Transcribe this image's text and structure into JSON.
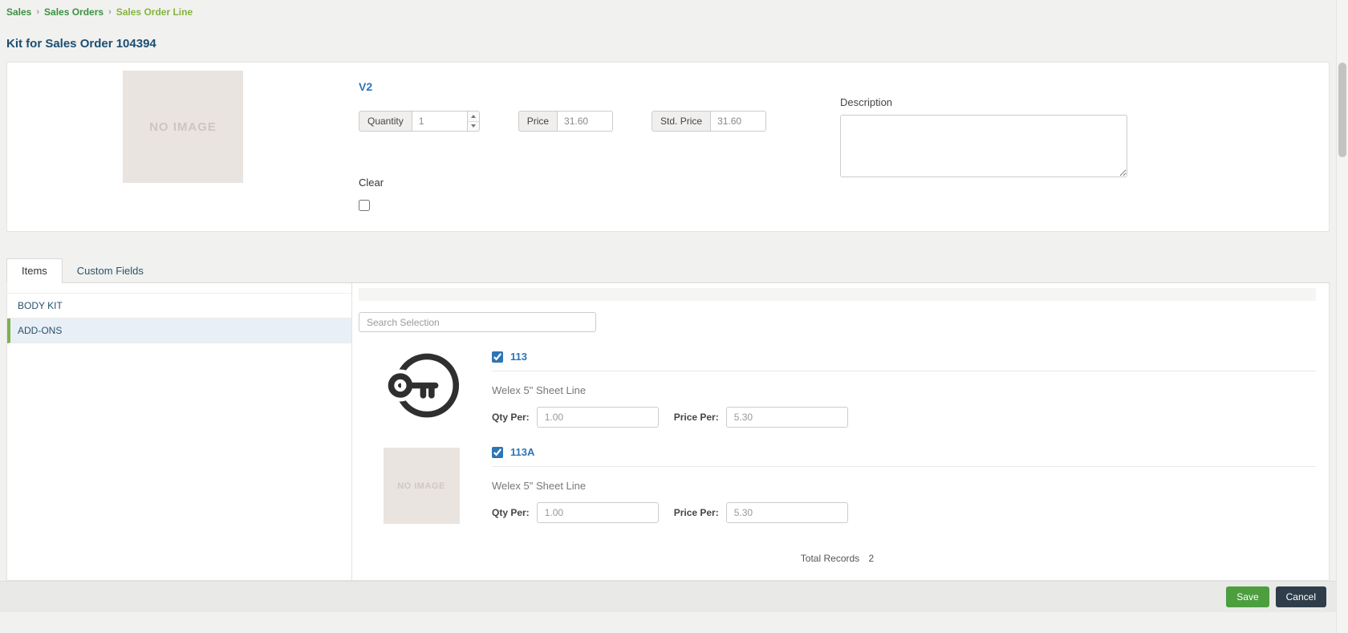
{
  "breadcrumb": {
    "separator": "›",
    "items": [
      {
        "label": "Sales"
      },
      {
        "label": "Sales Orders"
      },
      {
        "label": "Sales Order Line"
      }
    ]
  },
  "page": {
    "title": "Kit for Sales Order 104394"
  },
  "product_panel": {
    "image_placeholder": "NO IMAGE",
    "name": "V2",
    "quantity": {
      "label": "Quantity",
      "value": "1"
    },
    "price": {
      "label": "Price",
      "value": "31.60"
    },
    "std_price": {
      "label": "Std. Price",
      "value": "31.60"
    },
    "description": {
      "label": "Description",
      "value": ""
    },
    "clear": {
      "label": "Clear",
      "checked": false
    }
  },
  "tabs": [
    {
      "label": "Items",
      "active": true
    },
    {
      "label": "Custom Fields",
      "active": false
    }
  ],
  "categories": [
    {
      "label": "BODY KIT",
      "selected": false
    },
    {
      "label": "ADD-ONS",
      "selected": true
    }
  ],
  "search": {
    "placeholder": "Search Selection"
  },
  "items": [
    {
      "code": "113",
      "description": "Welex 5\" Sheet Line",
      "qty_per_label": "Qty Per:",
      "qty_per": "1.00",
      "price_per_label": "Price Per:",
      "price_per": "5.30",
      "checked": true,
      "image": "key-icon"
    },
    {
      "code": "113A",
      "description": "Welex 5\" Sheet Line",
      "qty_per_label": "Qty Per:",
      "qty_per": "1.00",
      "price_per_label": "Price Per:",
      "price_per": "5.30",
      "checked": true,
      "image": "no-image",
      "image_placeholder": "NO IMAGE"
    }
  ],
  "summary": {
    "total_records_label": "Total Records",
    "total_records_value": "2"
  },
  "footer": {
    "save": "Save",
    "cancel": "Cancel"
  },
  "colors": {
    "breadcrumb_green": "#3a9142",
    "breadcrumb_current_green": "#84b43e",
    "title_blue": "#1b4f72",
    "link_blue": "#2e75b6",
    "save_green": "#4c9e3f",
    "cancel_navy": "#2e3d49",
    "selected_category_bg": "#e9eff7",
    "selected_accent_green": "#7cb24a"
  }
}
